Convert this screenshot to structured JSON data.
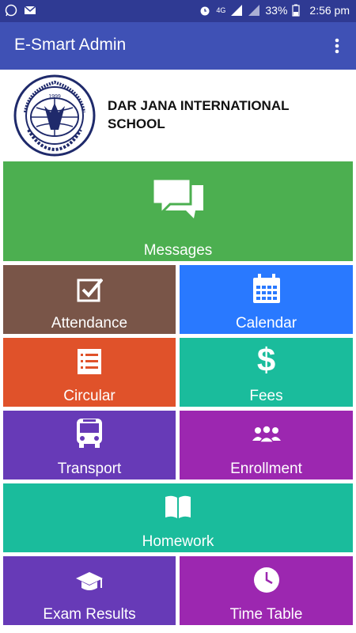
{
  "status": {
    "battery": "33%",
    "time": "2:56 pm",
    "network": "4G"
  },
  "appbar": {
    "title": "E-Smart Admin"
  },
  "header": {
    "school_name": "DAR JANA INTERNATIONAL SCHOOL",
    "logo_text": "DAR JANA INTERNATIONAL SCHOOL",
    "logo_year": "1999"
  },
  "colors": {
    "statusbar": "#2f3a93",
    "appbar": "#3f51b5",
    "messages": "#4caf50",
    "attendance": "#795548",
    "calendar": "#2979ff",
    "circular": "#e0522a",
    "fees": "#1abc9c",
    "transport": "#673ab7",
    "enrollment": "#9c27b0",
    "homework": "#1abc9c",
    "exam_results": "#673ab7",
    "time_table": "#9c27b0"
  },
  "tiles": {
    "messages": "Messages",
    "attendance": "Attendance",
    "calendar": "Calendar",
    "circular": "Circular",
    "fees": "Fees",
    "transport": "Transport",
    "enrollment": "Enrollment",
    "homework": "Homework",
    "exam_results": "Exam Results",
    "time_table": "Time Table"
  }
}
